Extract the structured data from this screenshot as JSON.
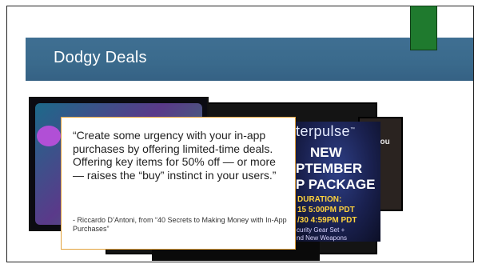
{
  "slide": {
    "title": "Dodgy Deals"
  },
  "quote": {
    "text": "“Create some urgency with your in-app purchases by offering limited-time deals. Offering key items for 50% off — or more — raises the “buy” instinct in your users.”",
    "citation": "- Riccardo D’Antoni, from “40 Secrets to Making Money with In-App Purchases”"
  },
  "screenshots": {
    "promo": {
      "brand": "terpulse",
      "brand_mark": "™",
      "line1": "NEW",
      "line2": "PTEMBER",
      "line3": "P PACKAGE",
      "duration_label": "DURATION:",
      "duration_start": "15 5:00PM PDT",
      "duration_end": "/30 4:59PM PDT",
      "footer_line1": "curity Gear Set +",
      "footer_line2": "nd New Weapons"
    },
    "right_text": "you"
  },
  "colors": {
    "title_band": "#3a6a8c",
    "accent": "#1f7a2e",
    "quote_border": "#e2a23c"
  }
}
